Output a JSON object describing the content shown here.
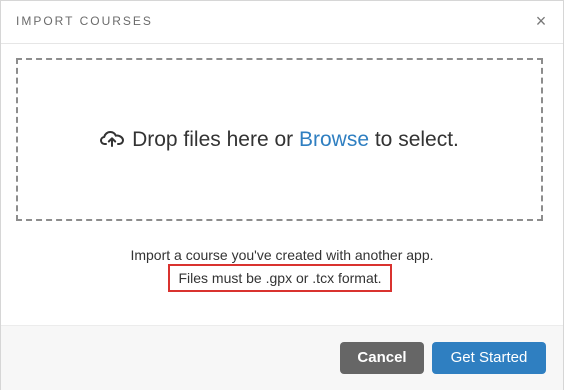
{
  "dialog": {
    "title": "IMPORT COURSES",
    "close_glyph": "×",
    "close_icon": "close-icon"
  },
  "dropzone": {
    "icon": "cloud-upload-icon",
    "text_before": "Drop files here or ",
    "browse_label": "Browse",
    "text_after": " to select."
  },
  "info": {
    "line1": "Import a course you've created with another app.",
    "format_note": "Files must be .gpx or .tcx format.",
    "highlight_color": "#d9322f"
  },
  "footer": {
    "cancel_label": "Cancel",
    "start_label": "Get Started"
  },
  "colors": {
    "primary": "#2f7fc1",
    "cancel": "#666666"
  }
}
